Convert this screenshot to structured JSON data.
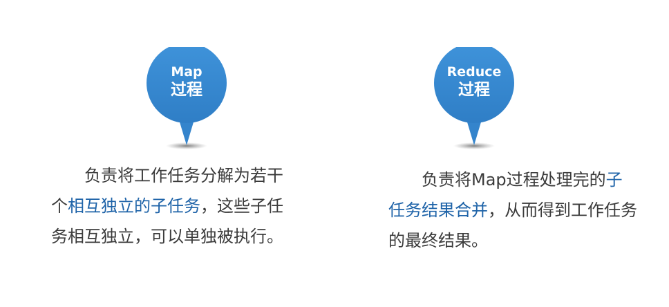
{
  "colors": {
    "pin_blue": "#3a8ad1",
    "pin_blue_dark": "#2f79c2",
    "text": "#3b3b3b",
    "highlight": "#1e63a8"
  },
  "map_pin": {
    "line1": "Map",
    "line2": "过程",
    "icon": "map-pin-icon"
  },
  "reduce_pin": {
    "line1": "Reduce",
    "line2": "过程",
    "icon": "map-pin-icon"
  },
  "map_desc": {
    "part1": "负责将工作任务分解为若干个",
    "highlight": "相互独立的子任务",
    "part2": "，这些子任务相互独立，可以单独被执行。"
  },
  "reduce_desc": {
    "part1": "负责将Map过程处理完的",
    "highlight": "子任务结果合并",
    "part2": "，从而得到工作任务的最终结果。"
  }
}
